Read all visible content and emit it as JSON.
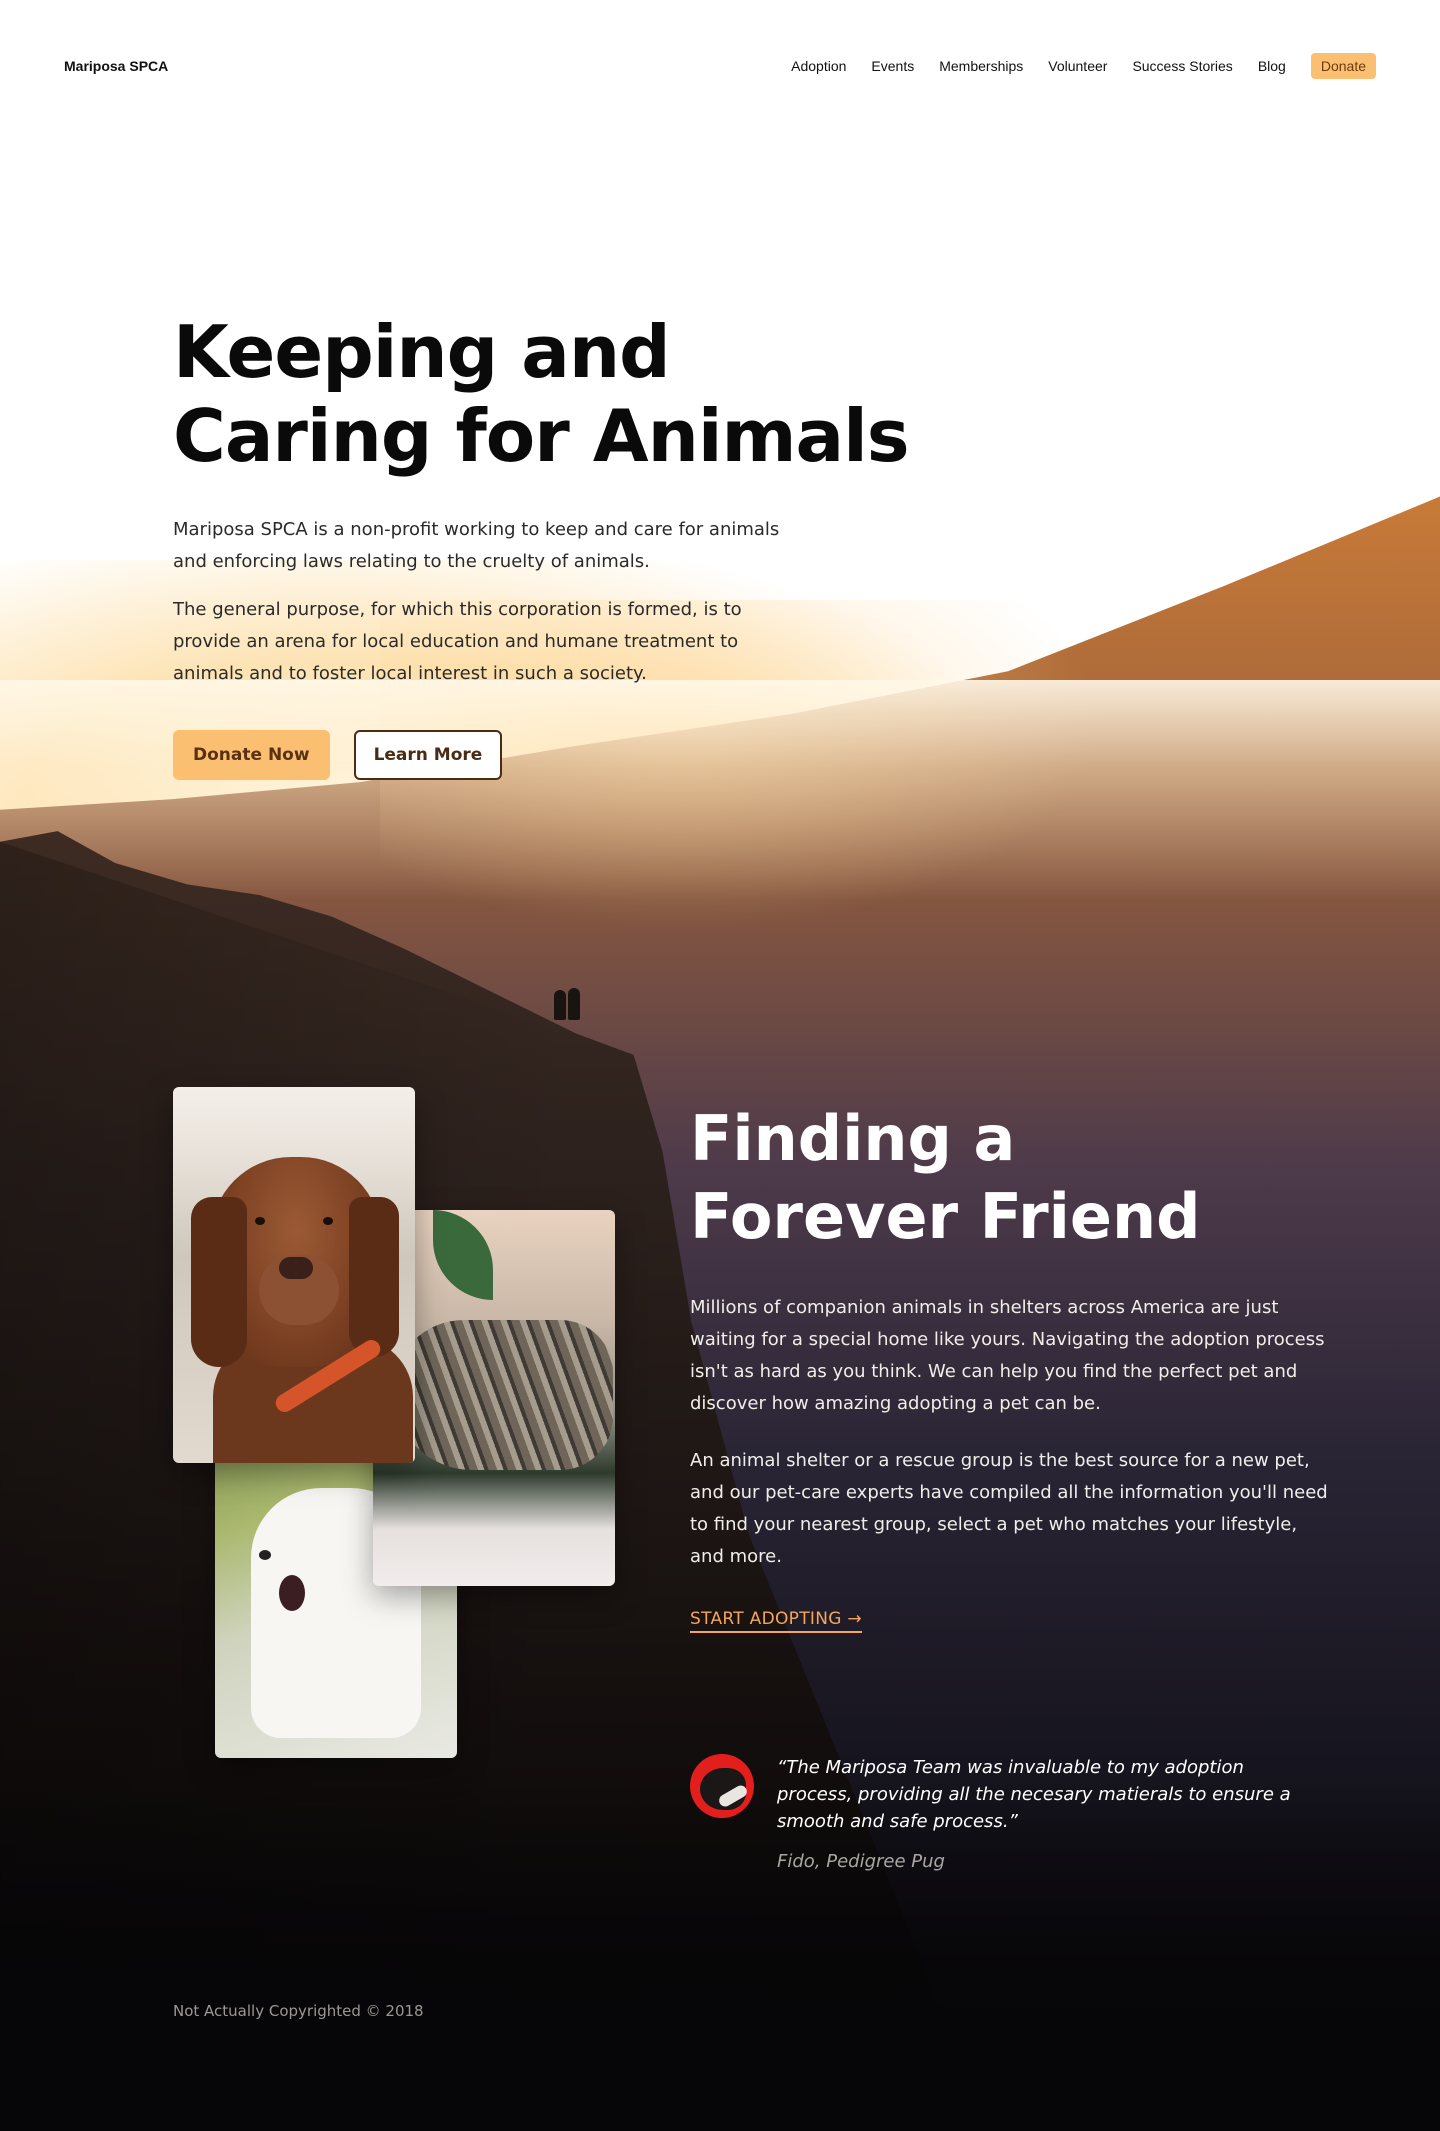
{
  "header": {
    "brand": "Mariposa SPCA",
    "nav": [
      "Adoption",
      "Events",
      "Memberships",
      "Volunteer",
      "Success Stories",
      "Blog"
    ],
    "donate_label": "Donate"
  },
  "hero": {
    "title_line1": "Keeping and",
    "title_line2": "Caring for Animals",
    "paragraph1": "Mariposa SPCA is a non-profit working to keep and care for animals and enforcing laws relating to the cruelty of animals.",
    "paragraph2": "The general purpose, for which this corporation is formed, is to provide an arena for local education and humane treatment to animals and to foster local interest in such a society.",
    "primary_button": "Donate Now",
    "secondary_button": "Learn More"
  },
  "section2": {
    "title_line1": "Finding a",
    "title_line2": "Forever Friend",
    "paragraph1": "Millions of companion animals in shelters across America are just waiting for a special home like yours. Navigating the adoption process isn't as hard as you think. We can help you find the perfect pet and discover how amazing adopting a pet can be.",
    "paragraph2": "An animal shelter or a rescue group is the best source for a new pet, and our pet-care experts have compiled all the information you'll need to find your nearest group, select a pet who matches your lifestyle, and more.",
    "cta": "START ADOPTING →"
  },
  "testimonial": {
    "quote": "“The Mariposa Team was invaluable to my adoption process, providing all the necesary matierals to ensure a smooth and safe process.”",
    "author": "Fido, Pedigree Pug"
  },
  "footer": {
    "copyright": "Not Actually Copyrighted © 2018"
  },
  "colors": {
    "accent": "#fbbf72",
    "link_accent": "#f6a55a",
    "outline": "#4a2c14"
  }
}
